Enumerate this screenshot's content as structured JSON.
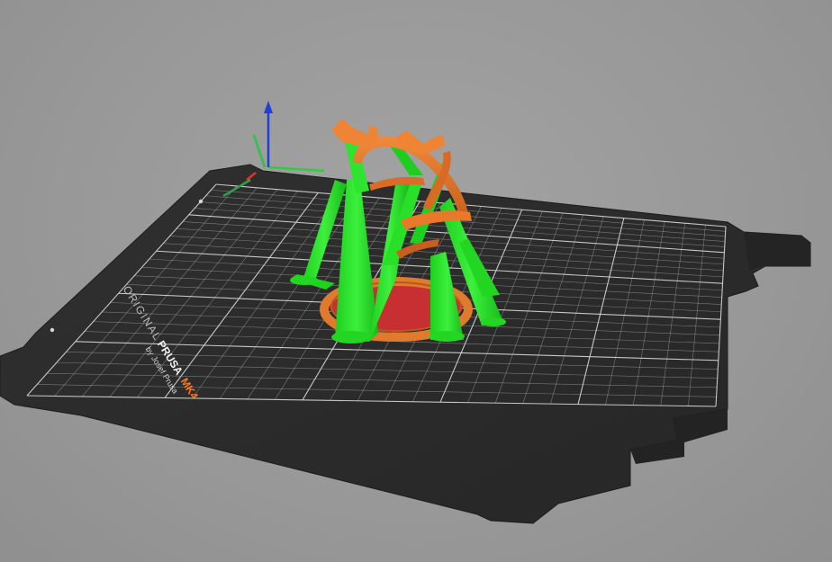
{
  "app": {
    "view": "3D preview",
    "printer": "Original Prusa MK4"
  },
  "bed": {
    "brand_line_1": "ORIGINAL",
    "brand_line_2": "PRUSA",
    "brand_model": "MK4",
    "brand_line_3": "by Josef Prusa",
    "surface_color": "#2c2c2c",
    "grid_color": "#d8d8d8",
    "accent_color": "#f47a20"
  },
  "axes": {
    "x_color": "#e0342a",
    "y_color": "#2ecc40",
    "z_color": "#1f3fd6"
  },
  "model": {
    "support_color": "#22dd22",
    "perimeter_color": "#e8782a",
    "infill_color": "#d63a3a"
  }
}
